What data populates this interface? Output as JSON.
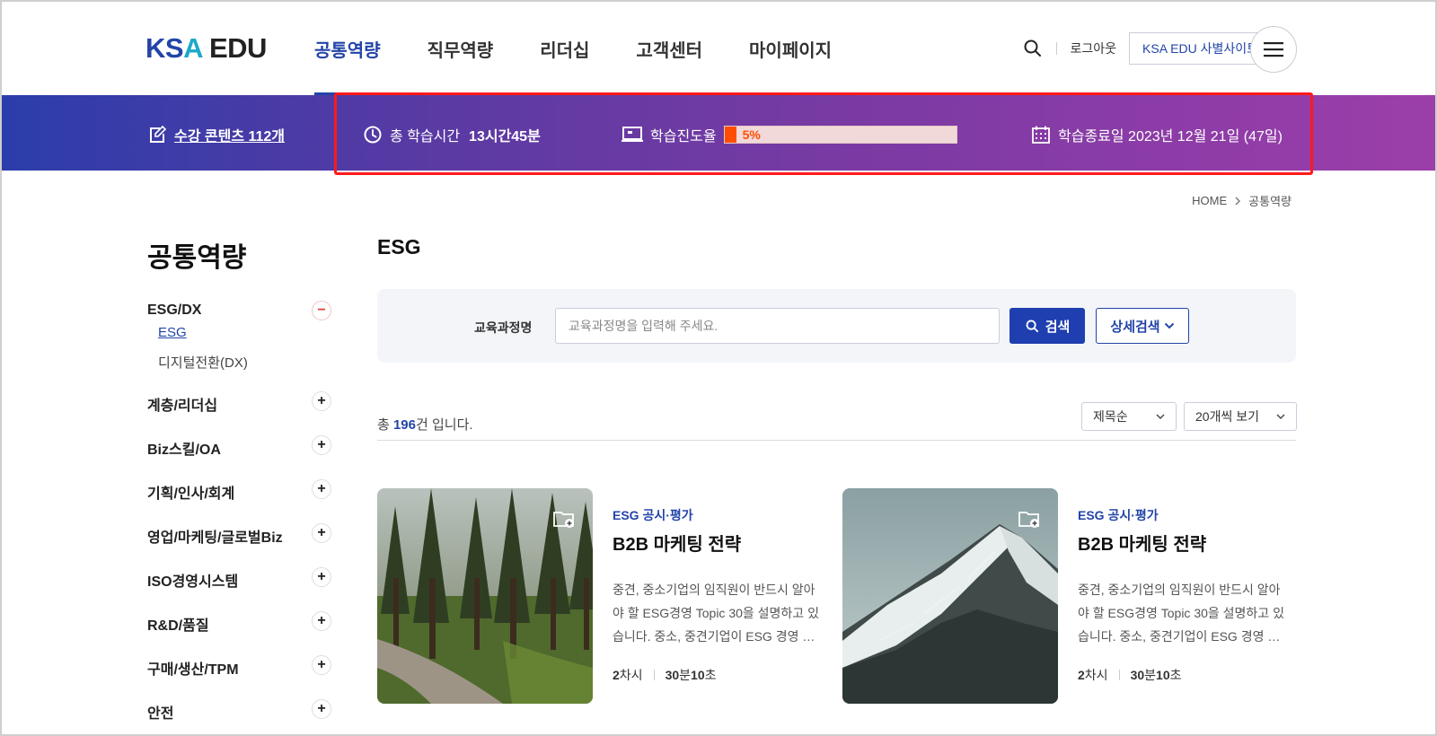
{
  "header": {
    "logo": {
      "k": "KS",
      "a": "A",
      "e": " EDU"
    },
    "nav": [
      "공통역량",
      "직무역량",
      "리더십",
      "고객센터",
      "마이페이지"
    ],
    "logout": "로그아웃",
    "site_button": "KSA EDU 사별사이트"
  },
  "banner": {
    "contents": "수강 콘텐츠 112개",
    "time_label": "총 학습시간",
    "time_value": "13시간45분",
    "progress_label": "학습진도율",
    "progress_text": "5%",
    "progress_fraction": 0.05,
    "end_date": "학습종료일 2023년 12월 21일 (47일)"
  },
  "breadcrumb": {
    "home": "HOME",
    "current": "공통역량"
  },
  "sidebar": {
    "title": "공통역량",
    "items": [
      {
        "label": "ESG/DX",
        "expanded": true,
        "children": [
          {
            "label": "ESG",
            "active": true
          },
          {
            "label": "디지털전환(DX)",
            "active": false
          }
        ]
      },
      {
        "label": "계층/리더십"
      },
      {
        "label": "Biz스킬/OA"
      },
      {
        "label": "기획/인사/회계"
      },
      {
        "label": "영업/마케팅/글로벌Biz"
      },
      {
        "label": "ISO경영시스템"
      },
      {
        "label": "R&D/품질"
      },
      {
        "label": "구매/생산/TPM"
      },
      {
        "label": "안전"
      }
    ]
  },
  "main": {
    "title": "ESG",
    "search": {
      "label": "교육과정명",
      "placeholder": "교육과정명을 입력해 주세요.",
      "submit": "검색",
      "detail": "상세검색"
    },
    "count_prefix": "총 ",
    "count": "196",
    "count_suffix": "건 입니다.",
    "sort_selected": "제목순",
    "size_selected": "20개씩 보기"
  },
  "cards": [
    {
      "category": "ESG 공시·평가",
      "title": "B2B 마케팅 전략",
      "desc": "중견, 중소기업의 임직원이 반드시 알아야 할 ESG경영 Topic 30을 설명하고 있습니다. 중소, 중견기업이 ESG 경영 …",
      "sessions_num": "2",
      "sessions_unit": "차시",
      "min": "30",
      "min_unit": "분 ",
      "sec": "10",
      "sec_unit": "초",
      "image": "forest-path"
    },
    {
      "category": "ESG 공시·평가",
      "title": "B2B 마케팅 전략",
      "desc": "중견, 중소기업의 임직원이 반드시 알아야 할 ESG경영 Topic 30을 설명하고 있습니다. 중소, 중견기업이 ESG 경영 …",
      "sessions_num": "2",
      "sessions_unit": "차시",
      "min": "30",
      "min_unit": "분 ",
      "sec": "10",
      "sec_unit": "초",
      "image": "snowy-mountain"
    }
  ],
  "colors": {
    "primary": "#2344a8",
    "progress": "#ff4e00",
    "highlight": "#ff1a1a"
  }
}
